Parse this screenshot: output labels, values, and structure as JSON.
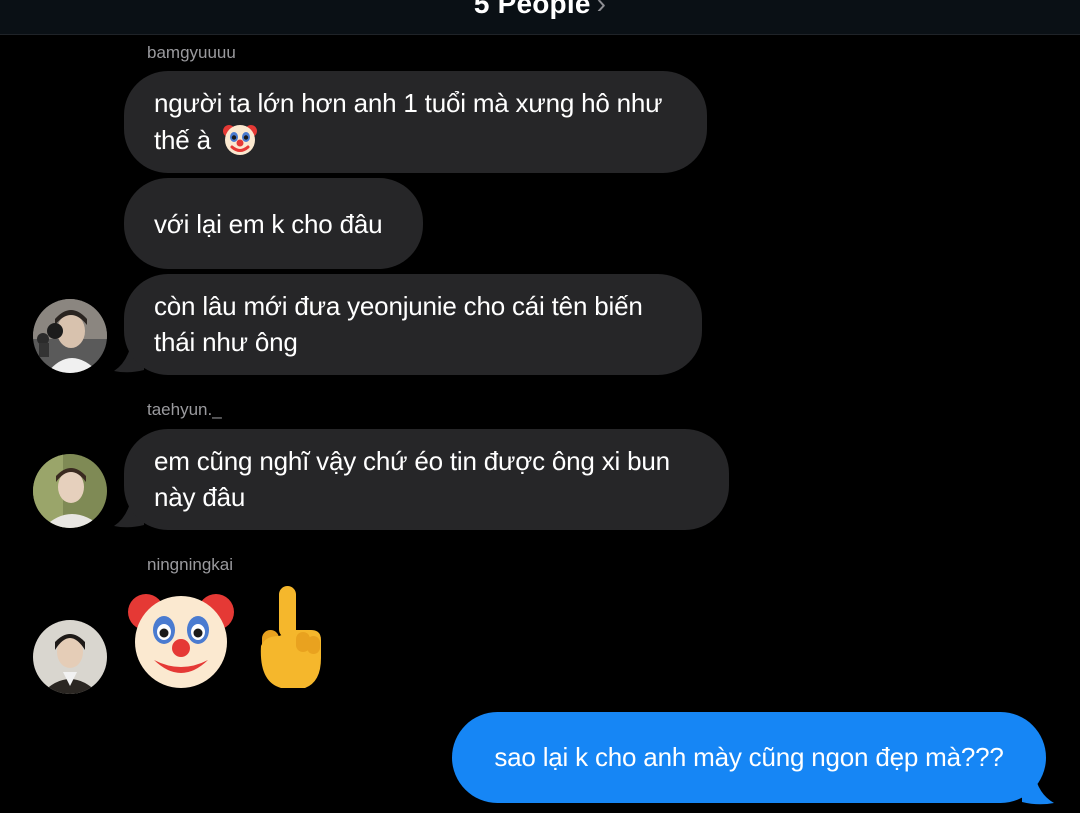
{
  "header": {
    "title": "5 People",
    "chevron": "›"
  },
  "messages": [
    {
      "sender": "bamgyuuuu"
    },
    {
      "text": "người ta lớn hơn anh 1 tuổi mà xưng hô như",
      "text2": "thế à",
      "emoji": "clown-face"
    },
    {
      "text": "với lại em k cho đâu"
    },
    {
      "text": "còn lâu mới đưa yeonjunie cho cái tên biến",
      "text2": "thái như ông"
    },
    {
      "sender": "taehyun._"
    },
    {
      "text": "em cũng nghĩ vậy chứ éo tin được ông xi bun",
      "text2": "này đâu"
    },
    {
      "sender": "ningningkai"
    },
    {
      "emojis": [
        "clown-face",
        "middle-finger"
      ]
    },
    {
      "text": "sao lại k cho anh mày cũng ngon đẹp mà???",
      "outgoing": true
    }
  ],
  "colors": {
    "incoming_bubble": "#262628",
    "outgoing_bubble": "#1686f5",
    "sender_text": "#9a9a9e",
    "background": "#000000"
  }
}
